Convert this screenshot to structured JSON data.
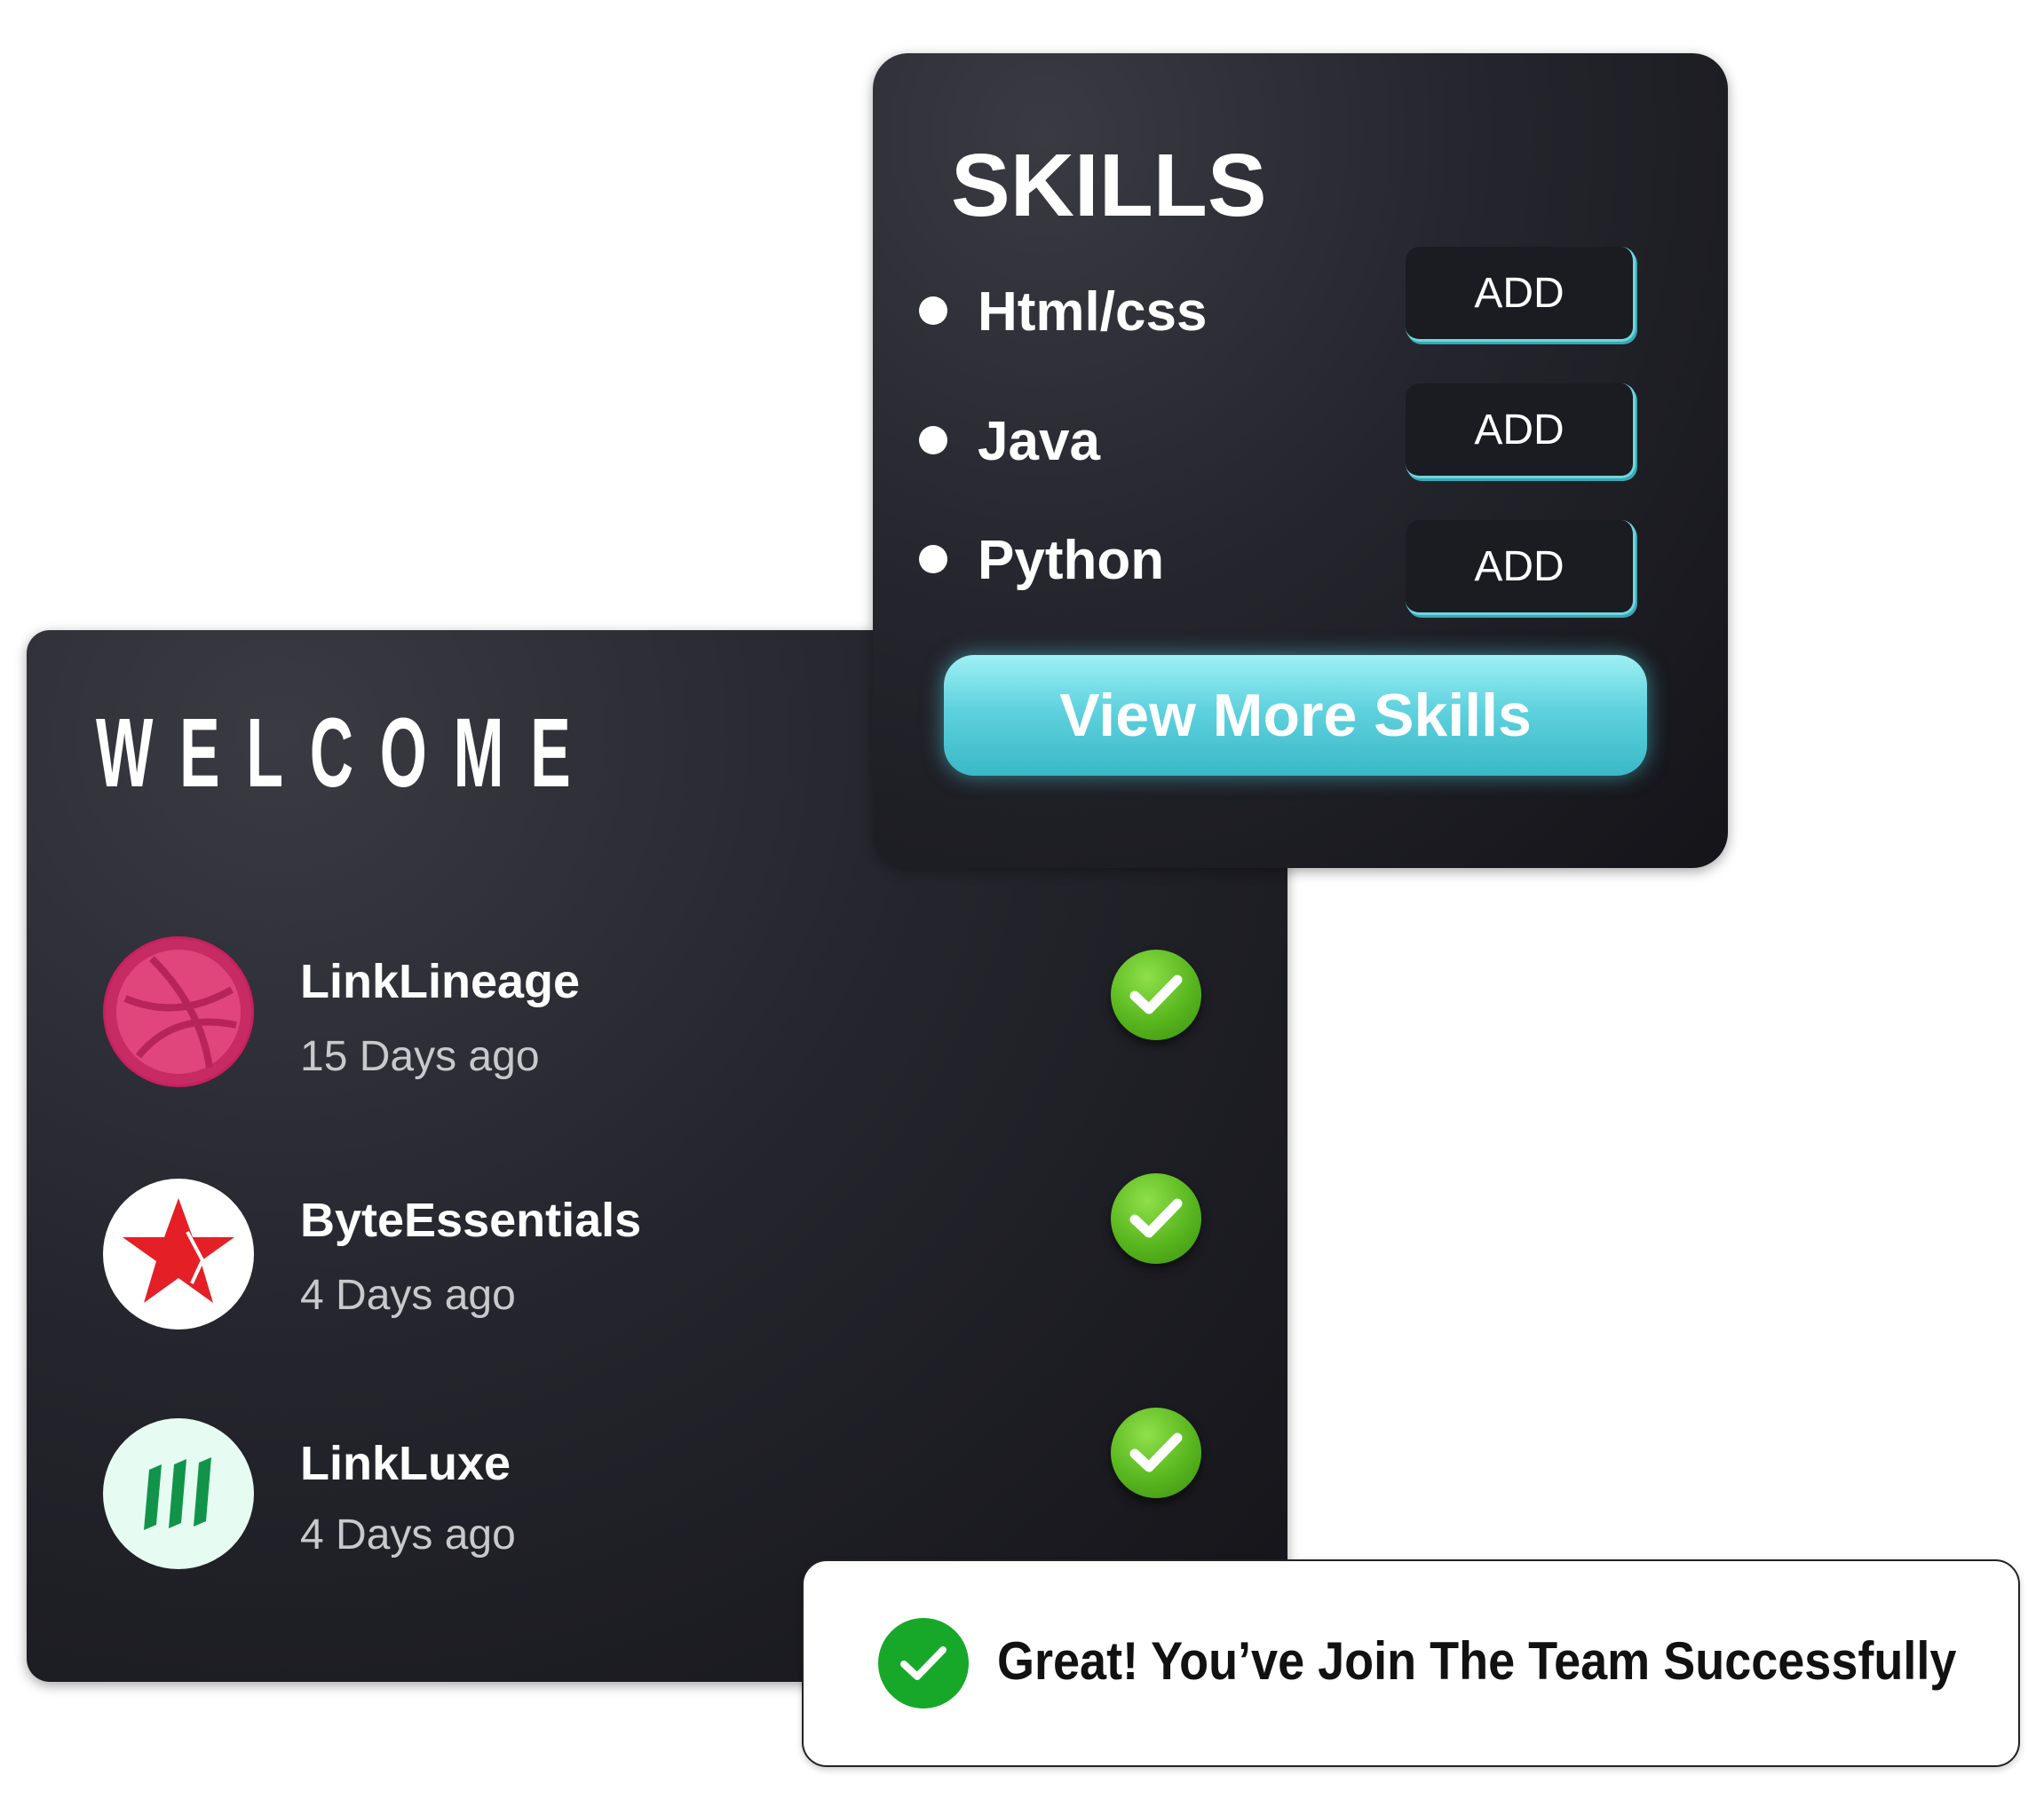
{
  "welcome": {
    "title": "WELCOME",
    "teams": [
      {
        "name": "LinkLineage",
        "time": "15 Days ago",
        "icon": "dribbble-icon",
        "color": "#e0457b"
      },
      {
        "name": "ByteEssentials",
        "time": "4 Days ago",
        "icon": "red-star-icon",
        "color": "#e51f26"
      },
      {
        "name": "LinkLuxe",
        "time": "4 Days ago",
        "icon": "green-bars-icon",
        "color": "#11944a"
      }
    ]
  },
  "skills": {
    "title": "SKILLS",
    "items": [
      {
        "label": "Html/css",
        "button": "ADD"
      },
      {
        "label": "Java",
        "button": "ADD"
      },
      {
        "label": "Python",
        "button": "ADD"
      }
    ],
    "view_more": "View More Skills",
    "accent": "#5fd2de"
  },
  "toast": {
    "message": "Great! You’ve Join The Team Successfully",
    "icon": "check-circle-icon",
    "color": "#17a82a"
  }
}
